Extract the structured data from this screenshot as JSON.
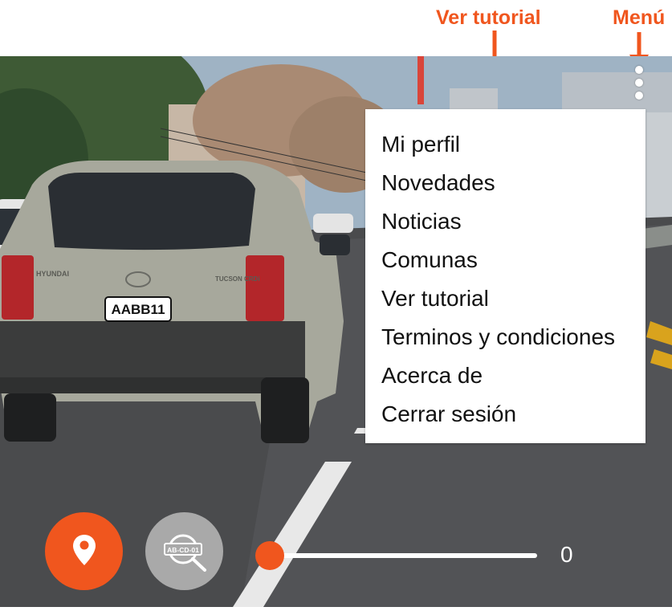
{
  "annotations": {
    "tutorial_label": "Ver tutorial",
    "menu_label": "Menú"
  },
  "scene": {
    "license_plate": "AABB11",
    "hood_badge_left": "HYUNDAI",
    "hood_badge_right": "TUCSON CRDi"
  },
  "menu": {
    "items": [
      "Mi perfil",
      "Novedades",
      "Noticias",
      "Comunas",
      "Ver tutorial",
      "Terminos y condiciones",
      "Acerca de",
      "Cerrar sesión"
    ]
  },
  "controls": {
    "location_icon": "map-pin-icon",
    "plate_search_icon": "plate-search-icon",
    "plate_search_badge": "AB-CD-01",
    "slider_value": "0",
    "slider_fraction": 0
  },
  "colors": {
    "accent": "#f0561e",
    "plate_button": "#a9a9a9"
  }
}
